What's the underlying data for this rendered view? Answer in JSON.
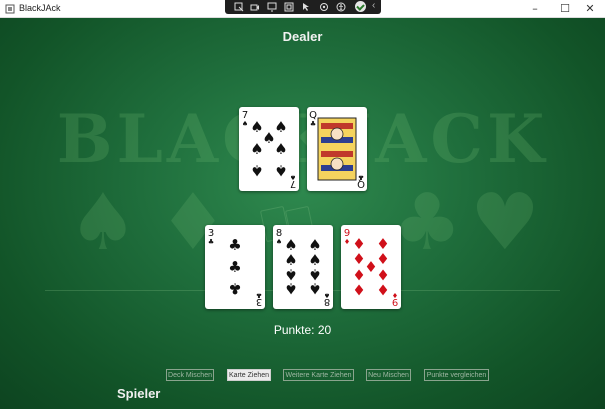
{
  "window": {
    "title": "BlackJAck",
    "controls": [
      "minimize",
      "maximize",
      "close"
    ]
  },
  "toolbar": {
    "icons": [
      "select-icon",
      "record-icon",
      "screen-icon",
      "frame-icon",
      "pointer-icon",
      "sensor-icon",
      "accessibility-icon",
      "check-icon",
      "collapse-icon"
    ]
  },
  "table": {
    "felt_text": "BLACKJACK",
    "dealer_label": "Dealer",
    "player_label": "Spieler",
    "points_text": "Punkte: 20",
    "colors": {
      "felt": "#1f6e3c",
      "red_suit": "#d0101a",
      "black_suit": "#111111"
    }
  },
  "dealer_cards": [
    {
      "rank": "7",
      "suit": "spades"
    },
    {
      "rank": "Q",
      "suit": "clubs"
    }
  ],
  "player_cards": [
    {
      "rank": "3",
      "suit": "clubs"
    },
    {
      "rank": "8",
      "suit": "spades"
    },
    {
      "rank": "9",
      "suit": "diamonds"
    }
  ],
  "buttons": [
    {
      "label": "Deck Mischen",
      "active": false
    },
    {
      "label": "Karte Ziehen",
      "active": true
    },
    {
      "label": "Weitere Karte Ziehen",
      "active": false
    },
    {
      "label": "Neu Mischen",
      "active": false
    },
    {
      "label": "Punkte vergleichen",
      "active": false
    }
  ]
}
